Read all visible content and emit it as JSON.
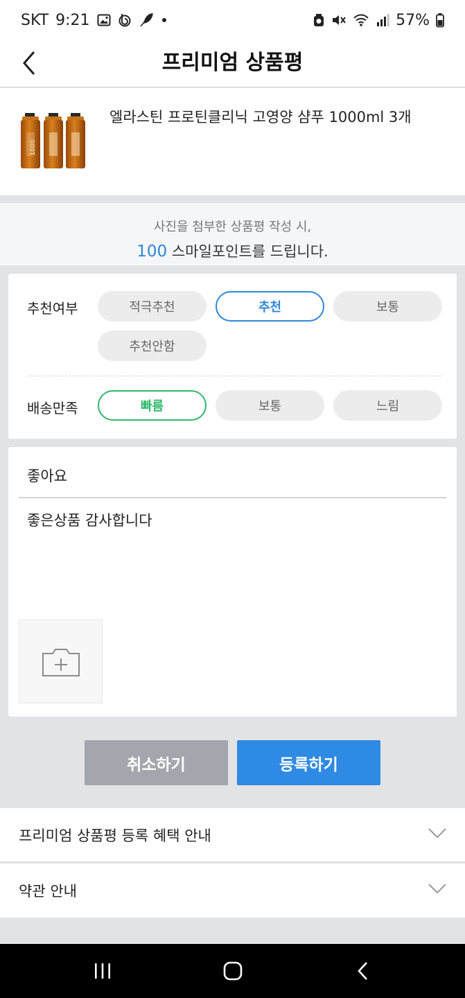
{
  "status_bar": {
    "carrier": "SKT",
    "time": "9:21",
    "battery": "57%",
    "icons_left": [
      "gallery-icon",
      "b-app-icon",
      "feather-icon",
      "dot-icon"
    ],
    "icons_right": [
      "alarm-icon",
      "mute-icon",
      "wifi-icon",
      "signal-icon",
      "battery-icon"
    ]
  },
  "header": {
    "title": "프리미엄 상품평"
  },
  "product": {
    "name": "엘라스틴 프로틴클리닉 고영양 샴푸 1000ml 3개",
    "bottle_label": "1000"
  },
  "notice": {
    "line1": "사진을 첨부한 상품평 작성 시,",
    "points": "100",
    "line2_suffix": "스마일포인트를 드립니다."
  },
  "rating": {
    "recommend_label": "추천여부",
    "recommend_options": [
      "적극추천",
      "추천",
      "보통",
      "추천안함"
    ],
    "recommend_selected": "추천",
    "delivery_label": "배송만족",
    "delivery_options": [
      "빠름",
      "보통",
      "느림"
    ],
    "delivery_selected": "빠름"
  },
  "review": {
    "title_value": "좋아요",
    "body_value": "좋은상품 감사합니다"
  },
  "buttons": {
    "cancel": "취소하기",
    "submit": "등록하기"
  },
  "accordions": [
    {
      "label": "프리미엄 상품평 등록 혜택 안내"
    },
    {
      "label": "약관 안내"
    }
  ],
  "colors": {
    "accent_blue": "#2f86d6",
    "accent_green": "#2fb86a",
    "submit_button": "#2f8ae3",
    "cancel_button": "#a3a7ad"
  }
}
